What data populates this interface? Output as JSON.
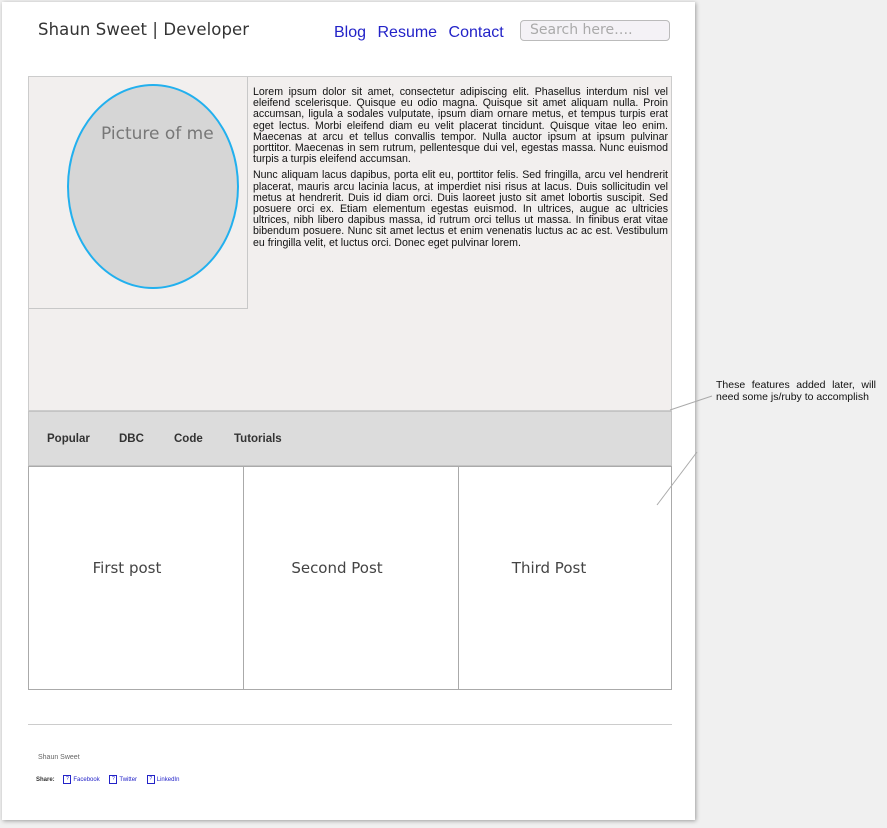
{
  "header": {
    "site_title": "Shaun Sweet | Developer",
    "nav": [
      {
        "label": "Blog"
      },
      {
        "label": "Resume"
      },
      {
        "label": "Contact"
      }
    ],
    "search_placeholder": "Search here…."
  },
  "hero": {
    "picture_label": "Picture of me",
    "paragraphs": [
      "Lorem ipsum dolor sit amet, consectetur adipiscing elit. Phasellus interdum nisl vel eleifend scelerisque. Quisque eu odio magna. Quisque sit amet aliquam nulla. Proin accumsan, ligula a sodales vulputate, ipsum diam ornare metus, et tempus turpis erat eget lectus. Morbi eleifend diam eu velit placerat tincidunt. Quisque vitae leo enim. Maecenas at arcu et tellus convallis tempor. Nulla auctor ipsum at ipsum pulvinar porttitor. Maecenas in sem rutrum, pellentesque dui vel, egestas massa. Nunc euismod turpis a turpis eleifend accumsan.",
      "Nunc aliquam lacus dapibus, porta elit eu, porttitor felis. Sed fringilla, arcu vel hendrerit placerat, mauris arcu lacinia lacus, at imperdiet nisi risus at lacus. Duis sollicitudin vel metus at hendrerit. Duis id diam orci. Duis laoreet justo sit amet lobortis suscipit. Sed posuere orci ex. Etiam elementum egestas euismod. In ultrices, augue ac ultricies ultrices, nibh libero dapibus massa, id rutrum orci tellus ut massa. In finibus erat vitae bibendum posuere. Nunc sit amet lectus et enim venenatis luctus ac ac est. Vestibulum eu fringilla velit, et luctus orci. Donec eget pulvinar lorem."
    ]
  },
  "tabs": [
    {
      "label": "Popular"
    },
    {
      "label": "DBC"
    },
    {
      "label": "Code"
    },
    {
      "label": "Tutorials"
    }
  ],
  "posts": [
    {
      "title": "First post"
    },
    {
      "title": "Second Post"
    },
    {
      "title": "Third Post"
    }
  ],
  "footer": {
    "name": "Shaun Sweet",
    "share_label": "Share:",
    "share_icon_glyph": "?",
    "share_links": [
      {
        "label": "Facebook"
      },
      {
        "label": "Twitter"
      },
      {
        "label": "LinkedIn"
      }
    ]
  },
  "annotation": {
    "note": "These features added later, will need some js/ruby to accomplish"
  },
  "colors": {
    "link": "#2323c8",
    "picture_border": "#22b0ee",
    "hero_bg": "#f2efee",
    "tabs_bg": "#dcdcdc"
  }
}
